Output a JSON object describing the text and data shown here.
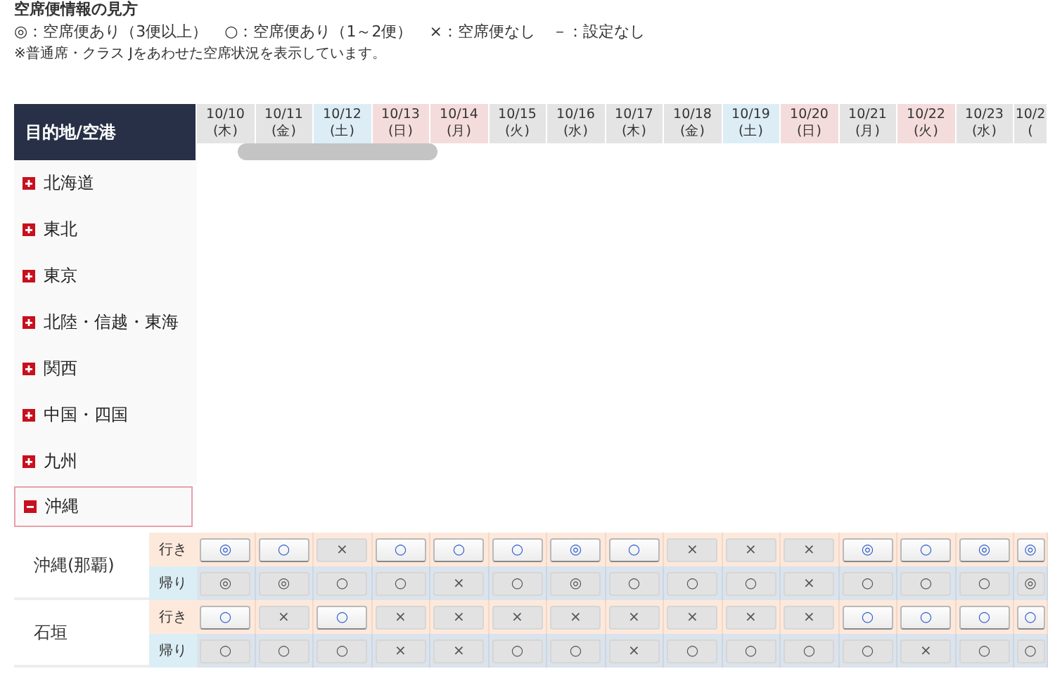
{
  "legend": {
    "title": "空席便情報の見方",
    "items": [
      "◎：空席便あり（3便以上）",
      "○：空席便あり（1～2便）",
      "×：空席便なし",
      "－：設定なし"
    ],
    "note": "※普通席・クラス Jをあわせた空席状況を表示しています。"
  },
  "table": {
    "header": "目的地/空港",
    "columns": [
      {
        "date": "10/10",
        "day": "(木)",
        "kind": "weekday"
      },
      {
        "date": "10/11",
        "day": "(金)",
        "kind": "weekday"
      },
      {
        "date": "10/12",
        "day": "(土)",
        "kind": "saturday"
      },
      {
        "date": "10/13",
        "day": "(日)",
        "kind": "holiday"
      },
      {
        "date": "10/14",
        "day": "(月)",
        "kind": "holiday"
      },
      {
        "date": "10/15",
        "day": "(火)",
        "kind": "weekday"
      },
      {
        "date": "10/16",
        "day": "(水)",
        "kind": "weekday"
      },
      {
        "date": "10/17",
        "day": "(木)",
        "kind": "weekday"
      },
      {
        "date": "10/18",
        "day": "(金)",
        "kind": "weekday"
      },
      {
        "date": "10/19",
        "day": "(土)",
        "kind": "saturday"
      },
      {
        "date": "10/20",
        "day": "(日)",
        "kind": "holiday"
      },
      {
        "date": "10/21",
        "day": "(月)",
        "kind": "weekday"
      },
      {
        "date": "10/22",
        "day": "(火)",
        "kind": "holiday"
      },
      {
        "date": "10/23",
        "day": "(水)",
        "kind": "weekday"
      },
      {
        "date": "10/2",
        "day": "(",
        "kind": "weekday"
      }
    ],
    "regions": [
      {
        "name": "北海道",
        "expanded": false
      },
      {
        "name": "東北",
        "expanded": false
      },
      {
        "name": "東京",
        "expanded": false
      },
      {
        "name": "北陸・信越・東海",
        "expanded": false
      },
      {
        "name": "関西",
        "expanded": false
      },
      {
        "name": "中国・四国",
        "expanded": false
      },
      {
        "name": "九州",
        "expanded": false
      },
      {
        "name": "沖縄",
        "expanded": true,
        "airports": [
          {
            "name": "沖縄(那覇)",
            "legs": [
              {
                "label": "行き",
                "kind": "outbound",
                "cells": [
                  {
                    "mark": "◎",
                    "enabled": true
                  },
                  {
                    "mark": "○",
                    "enabled": true
                  },
                  {
                    "mark": "×",
                    "enabled": false
                  },
                  {
                    "mark": "○",
                    "enabled": true
                  },
                  {
                    "mark": "○",
                    "enabled": true
                  },
                  {
                    "mark": "○",
                    "enabled": true
                  },
                  {
                    "mark": "◎",
                    "enabled": true
                  },
                  {
                    "mark": "○",
                    "enabled": true
                  },
                  {
                    "mark": "×",
                    "enabled": false
                  },
                  {
                    "mark": "×",
                    "enabled": false
                  },
                  {
                    "mark": "×",
                    "enabled": false
                  },
                  {
                    "mark": "◎",
                    "enabled": true
                  },
                  {
                    "mark": "○",
                    "enabled": true
                  },
                  {
                    "mark": "◎",
                    "enabled": true
                  },
                  {
                    "mark": "◎",
                    "enabled": true
                  }
                ]
              },
              {
                "label": "帰り",
                "kind": "return",
                "cells": [
                  {
                    "mark": "◎",
                    "enabled": false
                  },
                  {
                    "mark": "◎",
                    "enabled": false
                  },
                  {
                    "mark": "○",
                    "enabled": false
                  },
                  {
                    "mark": "○",
                    "enabled": false
                  },
                  {
                    "mark": "×",
                    "enabled": false
                  },
                  {
                    "mark": "○",
                    "enabled": false
                  },
                  {
                    "mark": "◎",
                    "enabled": false
                  },
                  {
                    "mark": "○",
                    "enabled": false
                  },
                  {
                    "mark": "○",
                    "enabled": false
                  },
                  {
                    "mark": "○",
                    "enabled": false
                  },
                  {
                    "mark": "×",
                    "enabled": false
                  },
                  {
                    "mark": "○",
                    "enabled": false
                  },
                  {
                    "mark": "○",
                    "enabled": false
                  },
                  {
                    "mark": "○",
                    "enabled": false
                  },
                  {
                    "mark": "◎",
                    "enabled": false
                  }
                ]
              }
            ]
          },
          {
            "name": "石垣",
            "legs": [
              {
                "label": "行き",
                "kind": "outbound",
                "cells": [
                  {
                    "mark": "○",
                    "enabled": true
                  },
                  {
                    "mark": "×",
                    "enabled": false
                  },
                  {
                    "mark": "○",
                    "enabled": true
                  },
                  {
                    "mark": "×",
                    "enabled": false
                  },
                  {
                    "mark": "×",
                    "enabled": false
                  },
                  {
                    "mark": "×",
                    "enabled": false
                  },
                  {
                    "mark": "×",
                    "enabled": false
                  },
                  {
                    "mark": "×",
                    "enabled": false
                  },
                  {
                    "mark": "×",
                    "enabled": false
                  },
                  {
                    "mark": "×",
                    "enabled": false
                  },
                  {
                    "mark": "×",
                    "enabled": false
                  },
                  {
                    "mark": "○",
                    "enabled": true
                  },
                  {
                    "mark": "○",
                    "enabled": true
                  },
                  {
                    "mark": "○",
                    "enabled": true
                  },
                  {
                    "mark": "○",
                    "enabled": true
                  }
                ]
              },
              {
                "label": "帰り",
                "kind": "return",
                "cells": [
                  {
                    "mark": "○",
                    "enabled": false
                  },
                  {
                    "mark": "○",
                    "enabled": false
                  },
                  {
                    "mark": "○",
                    "enabled": false
                  },
                  {
                    "mark": "×",
                    "enabled": false
                  },
                  {
                    "mark": "×",
                    "enabled": false
                  },
                  {
                    "mark": "○",
                    "enabled": false
                  },
                  {
                    "mark": "○",
                    "enabled": false
                  },
                  {
                    "mark": "×",
                    "enabled": false
                  },
                  {
                    "mark": "○",
                    "enabled": false
                  },
                  {
                    "mark": "○",
                    "enabled": false
                  },
                  {
                    "mark": "○",
                    "enabled": false
                  },
                  {
                    "mark": "○",
                    "enabled": false
                  },
                  {
                    "mark": "×",
                    "enabled": false
                  },
                  {
                    "mark": "○",
                    "enabled": false
                  },
                  {
                    "mark": "○",
                    "enabled": false
                  }
                ]
              }
            ]
          }
        ]
      }
    ]
  }
}
